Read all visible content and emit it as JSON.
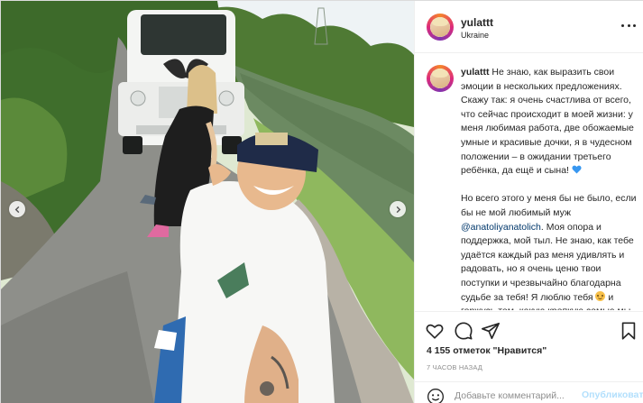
{
  "post": {
    "username": "yulattt",
    "location": "Ukraine",
    "caption": {
      "author": "yulattt",
      "paragraph1": "Не знаю, как выразить свои эмоции в нескольких предложениях. Скажу так: я очень счастлива от всего, что сейчас происходит в моей жизни: у меня любимая работа, две обожаемые умные и красивые дочки, я в чудесном положении – в ожидании третьего ребёнка, да ещё и сына!",
      "paragraph2_a": "Но всего этого у меня бы не было, если бы не мой любимый муж",
      "mention": "@anatoliyanatolich",
      "paragraph2_b": ". Моя опора и поддержка, мой тыл. Не знаю, как тебе удаётся каждый раз меня удивлять и радовать, но я очень ценю твои поступки и чрезвычайно благодарна судьбе за тебя! Я люблю тебя",
      "paragraph2_c": "и горжусь тем, какую крепкую семью мы смогли"
    },
    "likes_text": "4 155 отметок \"Нравится\"",
    "timestamp": "7 ЧАСОВ НАЗАД",
    "comment_placeholder": "Добавьте комментарий...",
    "publish_label": "Опубликовать"
  },
  "icons": {
    "more": "more-options-icon",
    "heart": "heart-icon",
    "comment": "comment-icon",
    "share": "share-icon",
    "save": "bookmark-icon",
    "emoji": "emoji-icon",
    "prev": "chevron-left-icon",
    "next": "chevron-right-icon"
  },
  "colors": {
    "link": "#00376b",
    "publish_disabled": "#b2dffc",
    "muted": "#8e8e8e",
    "heart_emoji": "#3897f0"
  }
}
